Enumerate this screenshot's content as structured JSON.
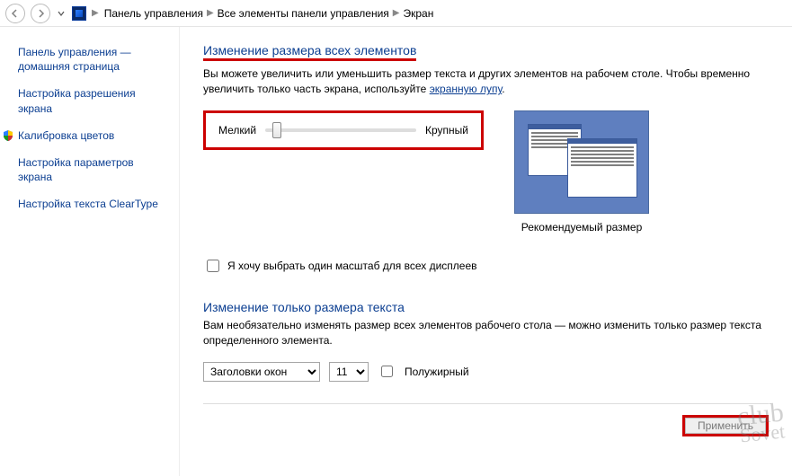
{
  "toolbar": {
    "breadcrumb": [
      "Панель управления",
      "Все элементы панели управления",
      "Экран"
    ]
  },
  "sidebar": {
    "items": [
      "Панель управления — домашняя страница",
      "Настройка разрешения экрана",
      "Калибровка цветов",
      "Настройка параметров экрана",
      "Настройка текста ClearType"
    ]
  },
  "main": {
    "heading": "Изменение размера всех элементов",
    "desc_pre": "Вы можете увеличить или уменьшить размер текста и других элементов на рабочем столе. Чтобы временно увеличить только часть экрана, используйте ",
    "desc_link": "экранную лупу",
    "desc_post": ".",
    "slider": {
      "min_label": "Мелкий",
      "max_label": "Крупный"
    },
    "preview_caption": "Рекомендуемый размер",
    "checkbox_label": "Я хочу выбрать один масштаб для всех дисплеев",
    "section2": {
      "heading": "Изменение только размера текста",
      "desc": "Вам необязательно изменять размер всех элементов рабочего стола — можно изменить только размер текста определенного элемента.",
      "element_select": "Заголовки окон",
      "size_select": "11",
      "bold_label": "Полужирный"
    },
    "apply_label": "Применить"
  },
  "watermark": {
    "line1": "club",
    "line2": "Sovet"
  }
}
